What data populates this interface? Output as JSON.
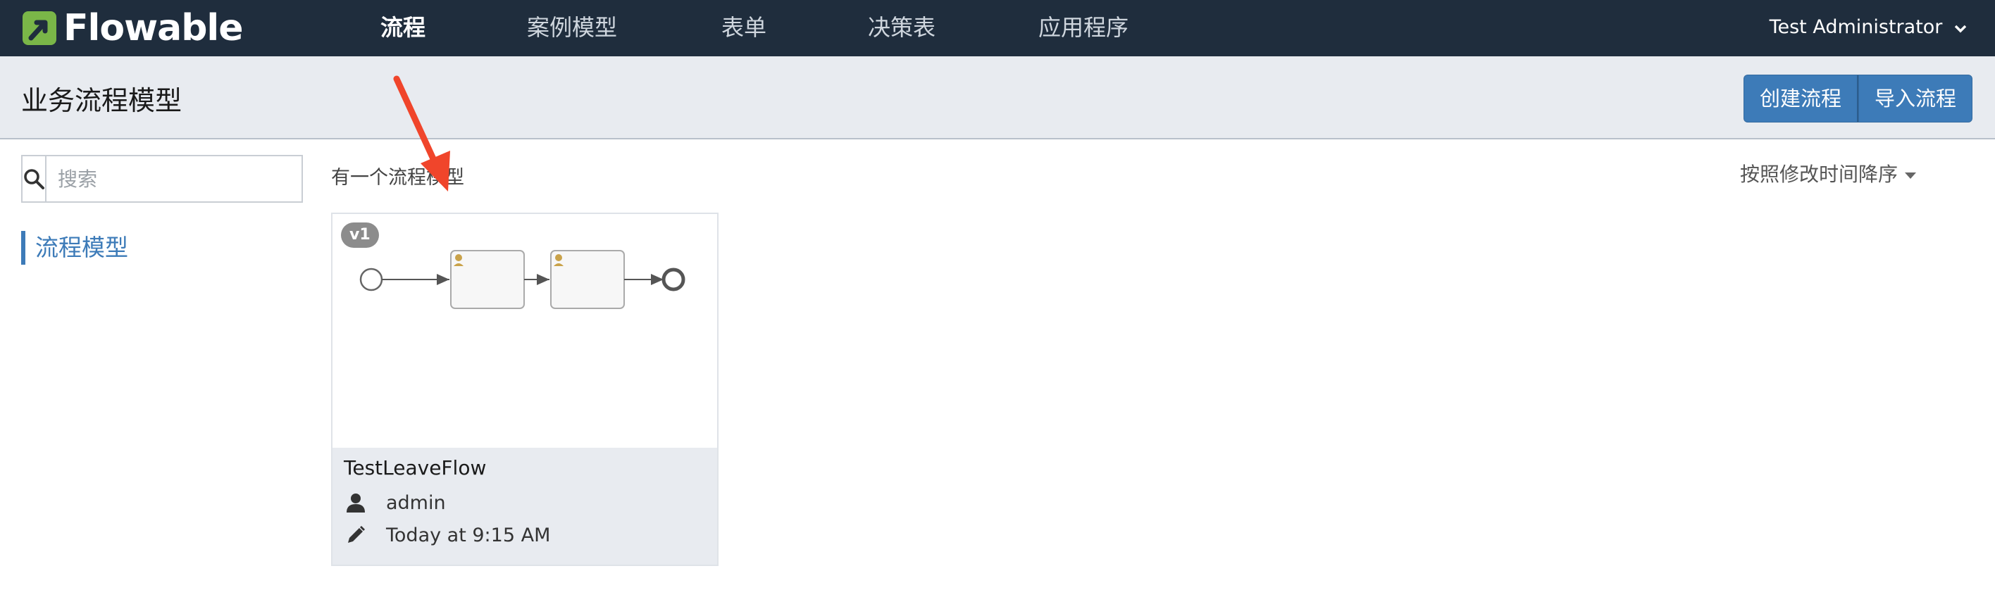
{
  "app": {
    "logo_text": "Flowable",
    "brand_color": "#7ab648",
    "nav_bg": "#1f2d3d",
    "accent": "#3d7bb8"
  },
  "nav": {
    "tabs": [
      {
        "label": "流程",
        "active": true
      },
      {
        "label": "案例模型",
        "active": false
      },
      {
        "label": "表单",
        "active": false
      },
      {
        "label": "决策表",
        "active": false
      },
      {
        "label": "应用程序",
        "active": false
      }
    ],
    "user": {
      "name": "Test Administrator",
      "icon": "chevron-down-icon"
    }
  },
  "header": {
    "title": "业务流程模型",
    "buttons": {
      "create": "创建流程",
      "import": "导入流程"
    }
  },
  "sidebar": {
    "search": {
      "placeholder": "搜索",
      "value": "",
      "icon": "search-icon"
    },
    "items": [
      {
        "label": "流程模型",
        "active": true
      }
    ]
  },
  "main": {
    "count_text": "有一个流程模型",
    "sort_label": "按照修改时间降序",
    "models": [
      {
        "name": "TestLeaveFlow",
        "version": "v1",
        "owner": "admin",
        "modified": "Today at 9:15 AM",
        "owner_icon": "user-icon",
        "modified_icon": "pencil-icon"
      }
    ]
  },
  "annotation": {
    "color": "#f0452b",
    "icon": "red-arrow-icon"
  }
}
